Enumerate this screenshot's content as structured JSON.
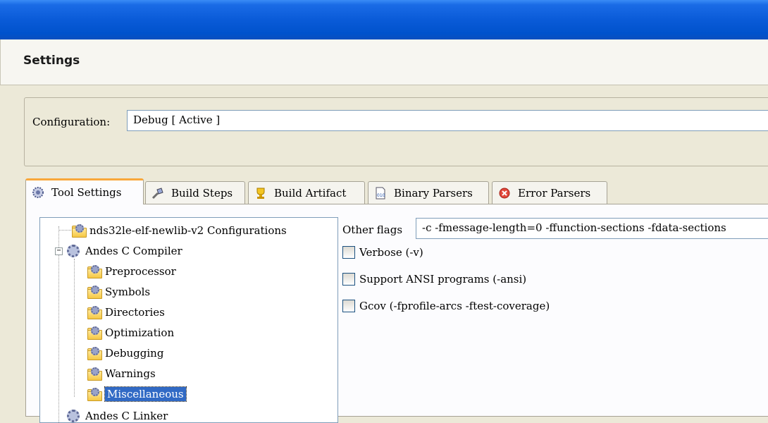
{
  "header": {
    "title": "Settings"
  },
  "configuration": {
    "label": "Configuration:",
    "value": "Debug  [ Active ]"
  },
  "tabs": [
    {
      "label": "Tool Settings",
      "icon": "gear-icon",
      "active": true
    },
    {
      "label": "Build Steps",
      "icon": "build-steps-icon",
      "active": false
    },
    {
      "label": "Build Artifact",
      "icon": "trophy-icon",
      "active": false
    },
    {
      "label": "Binary Parsers",
      "icon": "binary-icon",
      "active": false
    },
    {
      "label": "Error Parsers",
      "icon": "error-icon",
      "active": false
    }
  ],
  "tree": {
    "root": "nds32le-elf-newlib-v2 Configurations",
    "compiler": "Andes C Compiler",
    "children": [
      "Preprocessor",
      "Symbols",
      "Directories",
      "Optimization",
      "Debugging",
      "Warnings",
      "Miscellaneous"
    ],
    "selected": "Miscellaneous",
    "next_partial": "Andes C Linker"
  },
  "misc": {
    "other_flags_label": "Other flags",
    "other_flags_value": "-c -fmessage-length=0 -ffunction-sections -fdata-sections",
    "checkboxes": [
      {
        "label": "Verbose (-v)",
        "checked": false
      },
      {
        "label": "Support ANSI programs (-ansi)",
        "checked": false
      },
      {
        "label": "Gcov (-fprofile-arcs -ftest-coverage)",
        "checked": false
      }
    ]
  }
}
